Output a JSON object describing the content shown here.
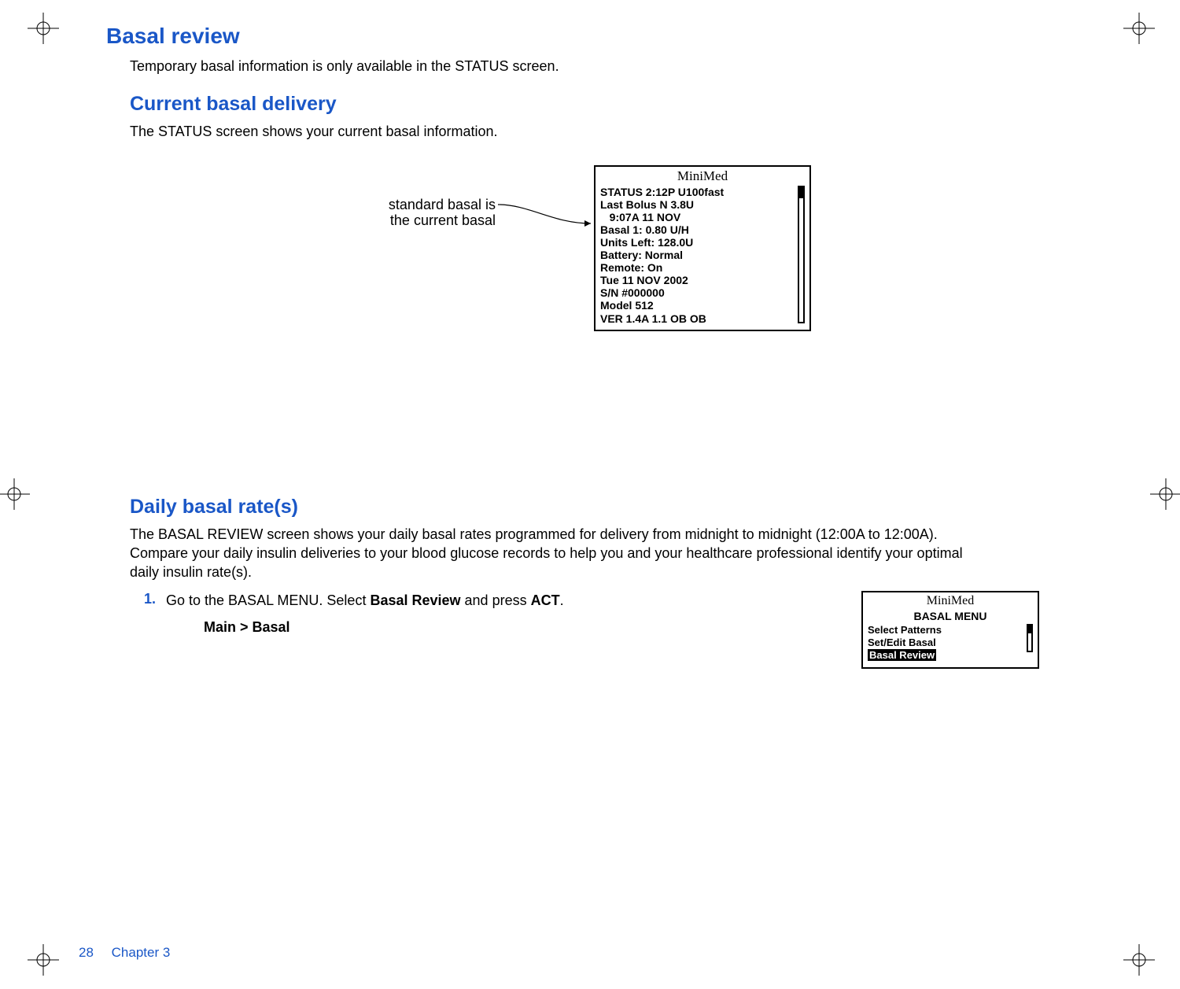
{
  "headings": {
    "h1": "Basal review",
    "h2a": "Current basal delivery",
    "h2b": "Daily basal rate(s)"
  },
  "paragraphs": {
    "p1": "Temporary basal information is only available in the STATUS screen.",
    "p2": "The STATUS screen shows your current basal information.",
    "p3": "The BASAL REVIEW screen shows your daily basal rates programmed for delivery from midnight to midnight (12:00A to 12:00A). Compare your daily insulin deliveries to your blood glucose records to help you and your healthcare professional identify your optimal daily insulin rate(s)."
  },
  "callout": "standard basal is the current basal",
  "lcd1": {
    "brand": "MiniMed",
    "lines": [
      "STATUS 2:12P U100fast",
      "Last Bolus N 3.8U",
      "   9:07A 11 NOV",
      "Basal 1: 0.80 U/H",
      "Units Left: 128.0U",
      "Battery: Normal",
      "Remote: On",
      "Tue 11 NOV 2002",
      "S/N #000000",
      "Model 512",
      "VER 1.4A 1.1 OB OB"
    ]
  },
  "step1": {
    "num": "1.",
    "text_pre": "Go to the BASAL MENU. Select ",
    "strong": "Basal Review",
    "text_mid": " and press ",
    "heavy": "ACT",
    "text_post": ".",
    "breadcrumb": "Main > Basal"
  },
  "lcd2": {
    "brand": "MiniMed",
    "title": "BASAL MENU",
    "items": [
      {
        "label": "Select Patterns",
        "selected": false
      },
      {
        "label": "Set/Edit Basal",
        "selected": false
      },
      {
        "label": "Basal Review",
        "selected": true
      }
    ]
  },
  "footer": {
    "page": "28",
    "chapter": "Chapter 3"
  }
}
